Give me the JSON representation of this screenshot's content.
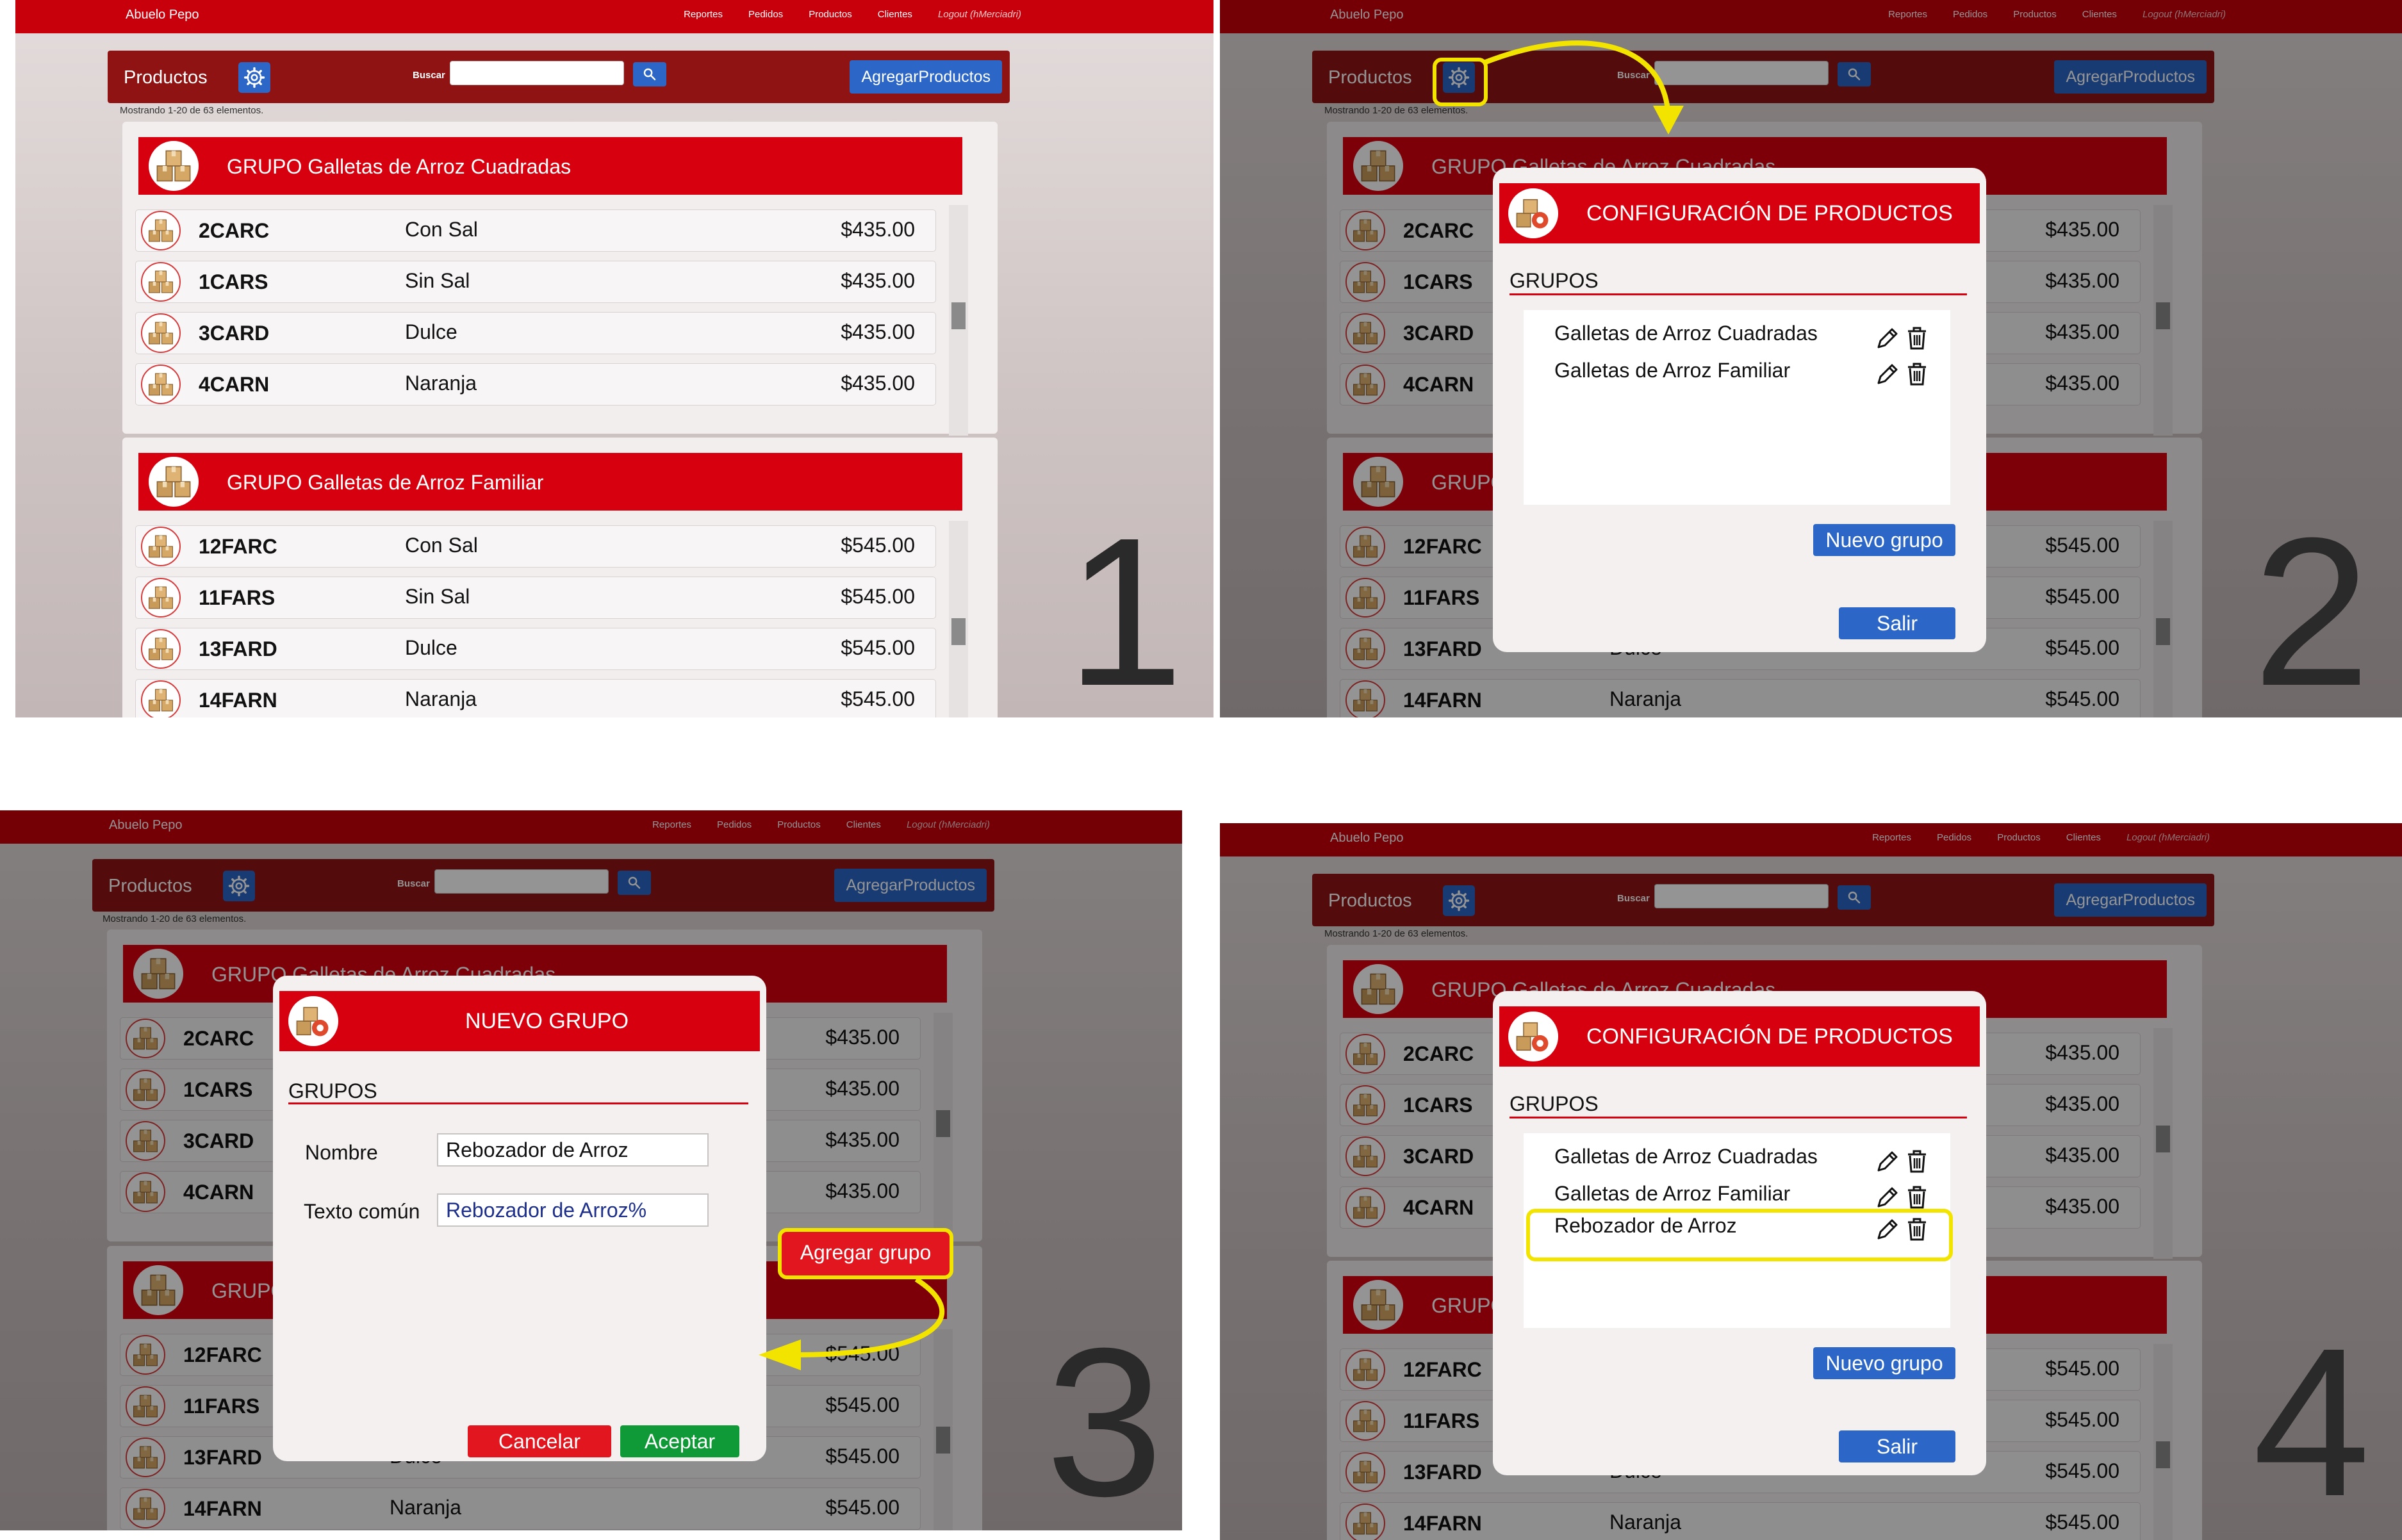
{
  "app": {
    "brand": "Abuelo Pepo",
    "nav": [
      "Reportes",
      "Pedidos",
      "Productos",
      "Clientes",
      "Logout (hMerciadri)"
    ],
    "toolbar_title": "Productos",
    "search_label": "Buscar",
    "add_button": "AgregarProductos",
    "showing": "Mostrando 1-20 de 63 elementos."
  },
  "groups": [
    {
      "title": "GRUPO Galletas de Arroz Cuadradas",
      "rows": [
        {
          "code": "2CARC",
          "desc": "Con Sal",
          "price": "$435.00"
        },
        {
          "code": "1CARS",
          "desc": "Sin Sal",
          "price": "$435.00"
        },
        {
          "code": "3CARD",
          "desc": "Dulce",
          "price": "$435.00"
        },
        {
          "code": "4CARN",
          "desc": "Naranja",
          "price": "$435.00"
        }
      ]
    },
    {
      "title": "GRUPO Galletas de Arroz Familiar",
      "rows": [
        {
          "code": "12FARC",
          "desc": "Con Sal",
          "price": "$545.00"
        },
        {
          "code": "11FARS",
          "desc": "Sin Sal",
          "price": "$545.00"
        },
        {
          "code": "13FARD",
          "desc": "Dulce",
          "price": "$545.00"
        },
        {
          "code": "14FARN",
          "desc": "Naranja",
          "price": "$545.00"
        }
      ]
    }
  ],
  "config_modal": {
    "title": "CONFIGURACIÓN DE PRODUCTOS",
    "section": "GRUPOS",
    "items": [
      "Galletas de Arroz Cuadradas",
      "Galletas de Arroz Familiar",
      "Rebozador de Arroz"
    ],
    "new_group_button": "Nuevo grupo",
    "exit_button": "Salir"
  },
  "new_group_modal": {
    "title": "NUEVO GRUPO",
    "section": "GRUPOS",
    "name_label": "Nombre",
    "name_value": "Rebozador de Arroz",
    "text_label": "Texto común",
    "text_value": "Rebozador de Arroz%",
    "add_group_button": "Agregar grupo",
    "cancel_button": "Cancelar",
    "accept_button": "Aceptar"
  },
  "steps": [
    "1",
    "2",
    "3",
    "4"
  ],
  "colors": {
    "navbar_red": "#c8000c",
    "toolbar_dark_red": "#8f1313",
    "group_header_red": "#d7000e",
    "primary_blue": "#2c67c7",
    "highlight_yellow": "#f3e400",
    "accept_green": "#0f9a37"
  },
  "icons": [
    "gear-icon",
    "search-icon",
    "box-stack-icon",
    "pencil-icon",
    "trash-icon"
  ]
}
